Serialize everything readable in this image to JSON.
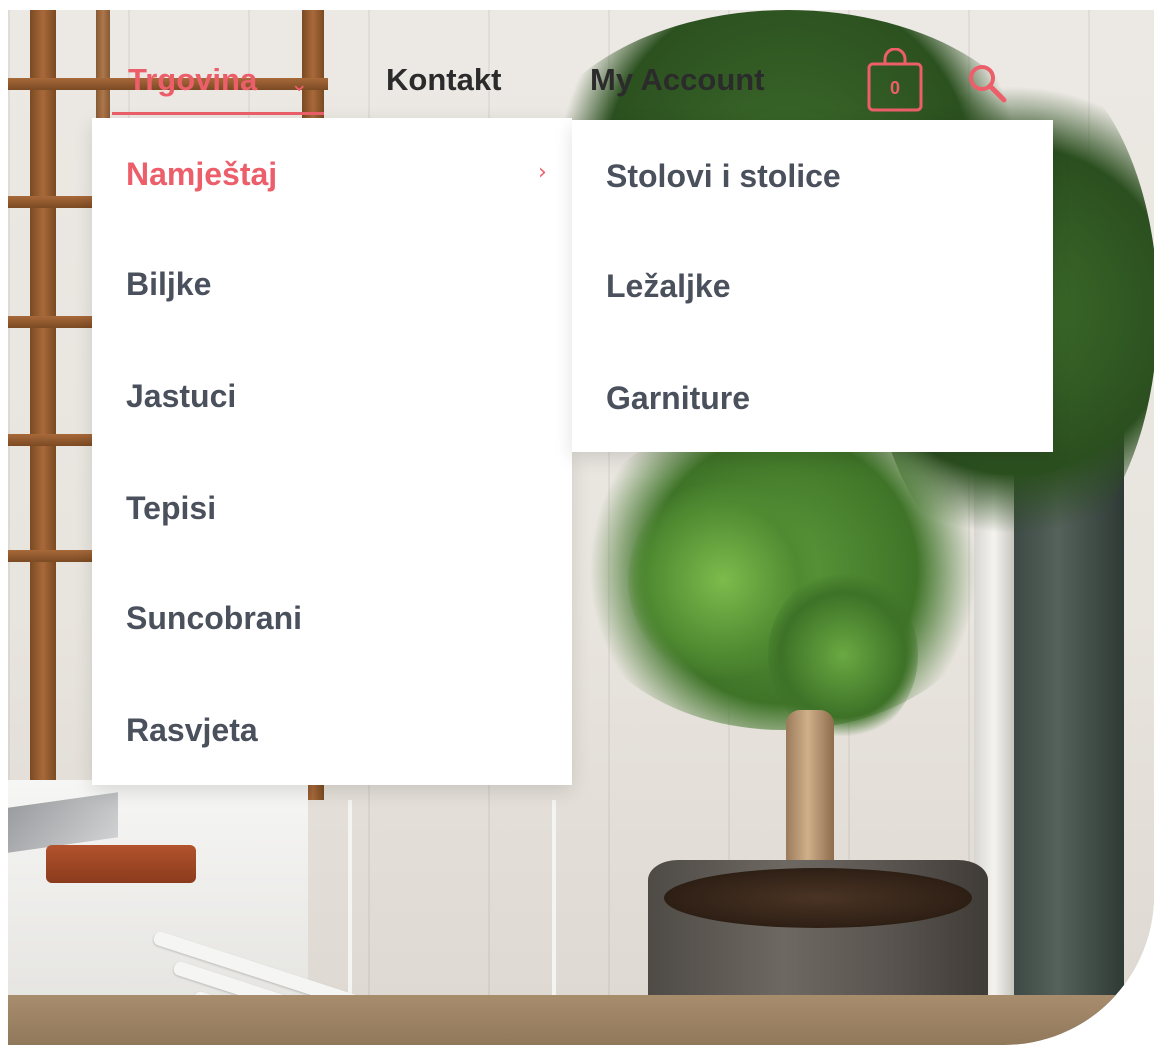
{
  "nav": {
    "items": [
      {
        "label": "Trgovina",
        "active": true
      },
      {
        "label": "Kontakt",
        "active": false
      },
      {
        "label": "My Account",
        "active": false
      }
    ],
    "cart_count": "0",
    "accent_color": "#ec5f6a"
  },
  "menu": {
    "items": [
      {
        "label": "Namještaj",
        "active": true,
        "has_submenu": true
      },
      {
        "label": "Biljke",
        "active": false
      },
      {
        "label": "Jastuci",
        "active": false
      },
      {
        "label": "Tepisi",
        "active": false
      },
      {
        "label": "Suncobrani",
        "active": false
      },
      {
        "label": "Rasvjeta",
        "active": false
      }
    ]
  },
  "submenu": {
    "items": [
      {
        "label": "Stolovi i stolice"
      },
      {
        "label": "Ležaljke"
      },
      {
        "label": "Garniture"
      }
    ]
  },
  "icons": {
    "nav_caret": "chevron-down-icon",
    "submenu_caret": "chevron-right-icon",
    "cart": "shopping-bag-icon",
    "search": "search-icon"
  }
}
